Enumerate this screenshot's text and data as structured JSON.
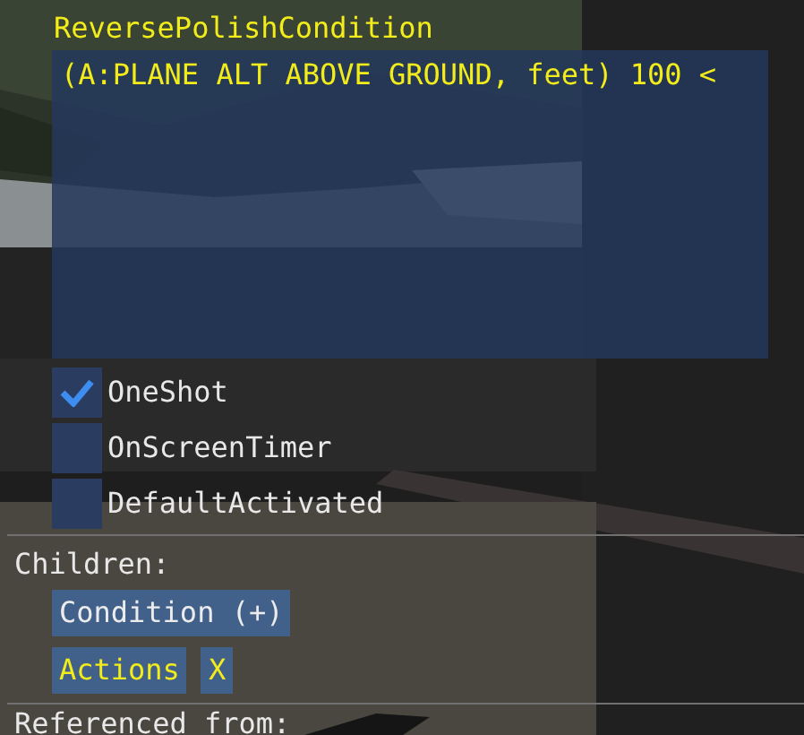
{
  "condition": {
    "label": "ReversePolishCondition",
    "value": "(A:PLANE ALT ABOVE GROUND, feet) 100 <"
  },
  "flags": [
    {
      "label": "OneShot",
      "checked": true
    },
    {
      "label": "OnScreenTimer",
      "checked": false
    },
    {
      "label": "DefaultActivated",
      "checked": false
    }
  ],
  "children": {
    "label": "Children:",
    "items": [
      {
        "label": "Condition (+)",
        "selected": false
      },
      {
        "label": "Actions",
        "selected": true,
        "remove": "X"
      }
    ]
  },
  "referenced": {
    "label": "Referenced from:"
  }
}
